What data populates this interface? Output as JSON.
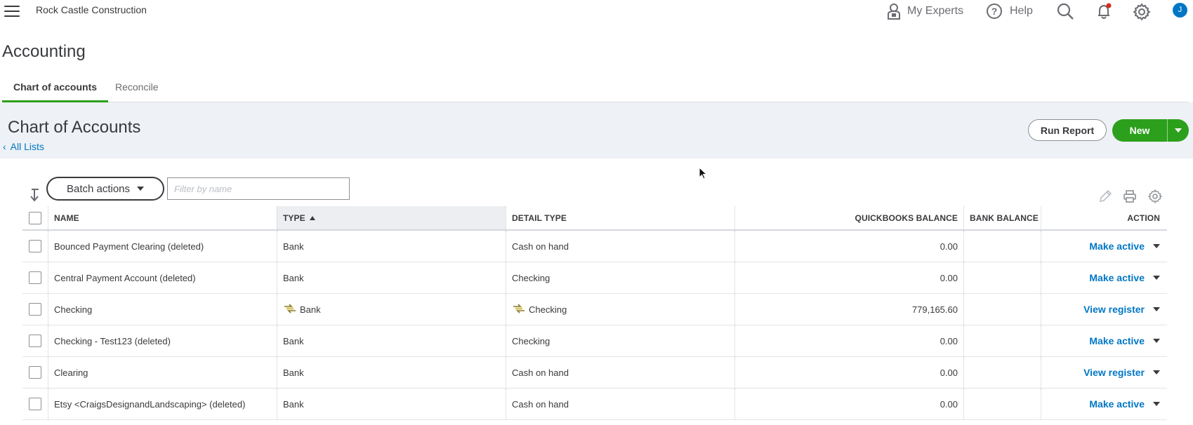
{
  "app": {
    "company": "Rock Castle Construction",
    "nav": {
      "my_experts": "My Experts",
      "help": "Help",
      "avatar_initial": "J"
    }
  },
  "page": {
    "title": "Accounting",
    "tabs": [
      {
        "label": "Chart of accounts",
        "active": true
      },
      {
        "label": "Reconcile",
        "active": false
      }
    ]
  },
  "header": {
    "title": "Chart of Accounts",
    "back_link": "All Lists",
    "run_report_label": "Run Report",
    "new_label": "New"
  },
  "toolbar": {
    "batch_actions_label": "Batch actions",
    "filter_placeholder": "Filter by name"
  },
  "table": {
    "columns": {
      "name": "NAME",
      "type": "TYPE",
      "detail_type": "DETAIL TYPE",
      "qb_balance": "QUICKBOOKS BALANCE",
      "bank_balance": "BANK BALANCE",
      "action": "ACTION"
    },
    "rows": [
      {
        "name": "Bounced Payment Clearing (deleted)",
        "type": "Bank",
        "detail_type": "Cash on hand",
        "qb_balance": "0.00",
        "bank_balance": "",
        "action": "Make active",
        "linked": false
      },
      {
        "name": "Central Payment Account (deleted)",
        "type": "Bank",
        "detail_type": "Checking",
        "qb_balance": "0.00",
        "bank_balance": "",
        "action": "Make active",
        "linked": false
      },
      {
        "name": "Checking",
        "type": "Bank",
        "detail_type": "Checking",
        "qb_balance": "779,165.60",
        "bank_balance": "",
        "action": "View register",
        "linked": true
      },
      {
        "name": "Checking - Test123 (deleted)",
        "type": "Bank",
        "detail_type": "Checking",
        "qb_balance": "0.00",
        "bank_balance": "",
        "action": "Make active",
        "linked": false
      },
      {
        "name": "Clearing",
        "type": "Bank",
        "detail_type": "Cash on hand",
        "qb_balance": "0.00",
        "bank_balance": "",
        "action": "View register",
        "linked": false
      },
      {
        "name": "Etsy <CraigsDesignandLandscaping> (deleted)",
        "type": "Bank",
        "detail_type": "Cash on hand",
        "qb_balance": "0.00",
        "bank_balance": "",
        "action": "Make active",
        "linked": false
      }
    ]
  },
  "colors": {
    "accent_green": "#2ca01c",
    "link_blue": "#0077c5",
    "band_bg": "#eef1f5",
    "notification_red": "#d52b1e"
  },
  "icons": [
    "hamburger-icon",
    "expert-icon",
    "help-icon",
    "search-icon",
    "bell-icon",
    "gear-icon",
    "pencil-icon",
    "print-icon",
    "settings-icon",
    "bank-link-icon"
  ]
}
